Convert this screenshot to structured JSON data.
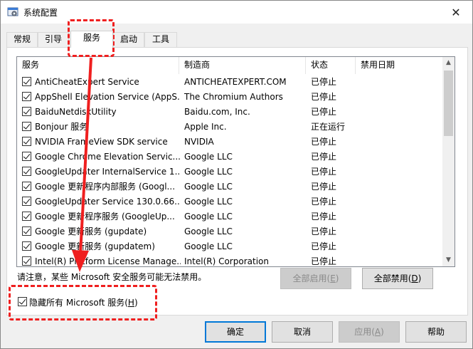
{
  "window": {
    "title": "系统配置",
    "close_glyph": "✕",
    "icon": "settings-app-icon"
  },
  "tabs": [
    {
      "label": "常规"
    },
    {
      "label": "引导"
    },
    {
      "label": "服务"
    },
    {
      "label": "启动"
    },
    {
      "label": "工具"
    }
  ],
  "list": {
    "columns": [
      "服务",
      "制造商",
      "状态",
      "禁用日期"
    ],
    "rows": [
      {
        "name": "AntiCheatExpert Service",
        "maker": "ANTICHEATEXPERT.COM",
        "status": "已停止",
        "date": ""
      },
      {
        "name": "AppShell Elevation Service (AppS...",
        "maker": "The Chromium Authors",
        "status": "已停止",
        "date": ""
      },
      {
        "name": "BaiduNetdiskUtility",
        "maker": "Baidu.com, Inc.",
        "status": "已停止",
        "date": ""
      },
      {
        "name": "Bonjour 服务",
        "maker": "Apple Inc.",
        "status": "正在运行",
        "date": ""
      },
      {
        "name": "NVIDIA FrameView SDK service",
        "maker": "NVIDIA",
        "status": "已停止",
        "date": ""
      },
      {
        "name": "Google Chrome Elevation Servic...",
        "maker": "Google LLC",
        "status": "已停止",
        "date": ""
      },
      {
        "name": "GoogleUpdater InternalService 1...",
        "maker": "Google LLC",
        "status": "已停止",
        "date": ""
      },
      {
        "name": "Google 更新程序内部服务 (Googl...",
        "maker": "Google LLC",
        "status": "已停止",
        "date": ""
      },
      {
        "name": "GoogleUpdater Service 130.0.66...",
        "maker": "Google LLC",
        "status": "已停止",
        "date": ""
      },
      {
        "name": "Google 更新程序服务 (GoogleUp...",
        "maker": "Google LLC",
        "status": "已停止",
        "date": ""
      },
      {
        "name": "Google 更新服务 (gupdate)",
        "maker": "Google LLC",
        "status": "已停止",
        "date": ""
      },
      {
        "name": "Google 更新服务 (gupdatem)",
        "maker": "Google LLC",
        "status": "已停止",
        "date": ""
      },
      {
        "name": "Intel(R) Platform License Manage...",
        "maker": "Intel(R) Corporation",
        "status": "已停止",
        "date": ""
      }
    ]
  },
  "note": "请注意，某些 Microsoft 安全服务可能无法禁用。",
  "buttons": {
    "enable_all": {
      "label": "全部启用(",
      "key": "E",
      "suffix": ")"
    },
    "disable_all": {
      "label": "全部禁用(",
      "key": "D",
      "suffix": ")"
    },
    "ok": "确定",
    "cancel": "取消",
    "apply": {
      "label": "应用(",
      "key": "A",
      "suffix": ")"
    },
    "help": "帮助"
  },
  "hide_ms": {
    "label": "隐藏所有 Microsoft 服务(",
    "key": "H",
    "suffix": ")",
    "checked": true
  },
  "annotation_color": "#ef1f1f"
}
